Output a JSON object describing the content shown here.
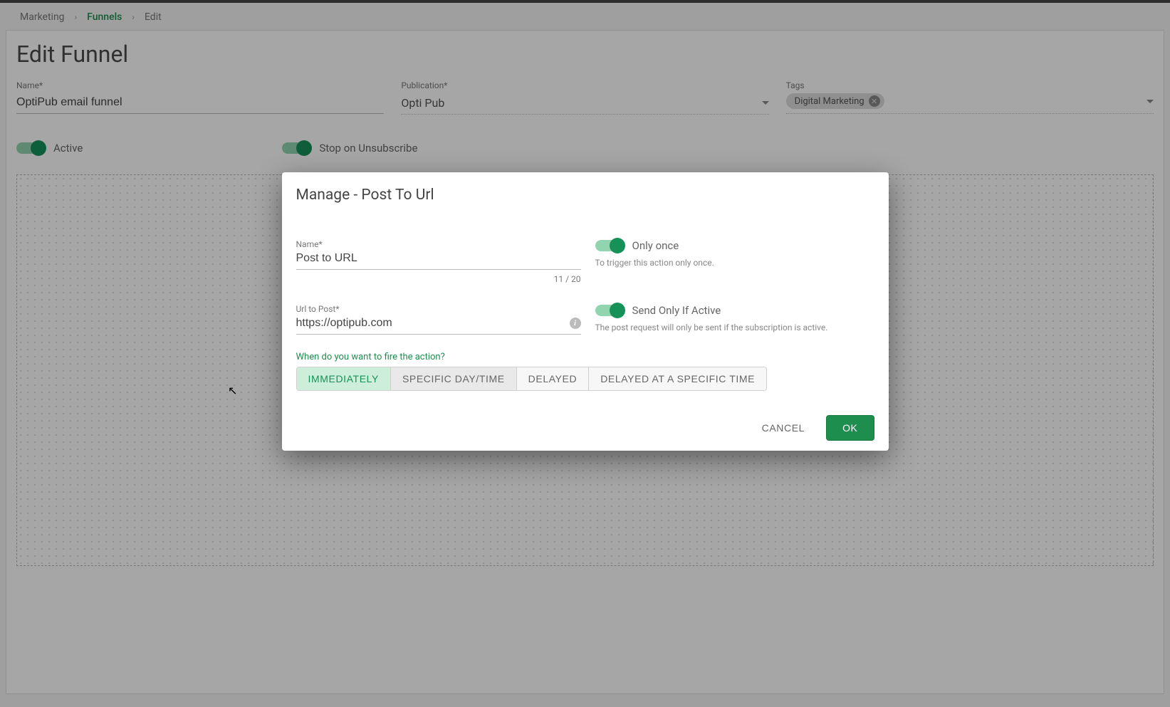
{
  "breadcrumb": {
    "items": [
      "Marketing",
      "Funnels",
      "Edit"
    ],
    "active_index": 1
  },
  "page": {
    "title": "Edit Funnel"
  },
  "fields": {
    "name_label": "Name*",
    "name_value": "OptiPub email funnel",
    "publication_label": "Publication*",
    "publication_value": "Opti Pub",
    "tags_label": "Tags",
    "tags": [
      "Digital Marketing"
    ]
  },
  "toggles": {
    "active_label": "Active",
    "stop_label": "Stop on Unsubscribe"
  },
  "modal": {
    "title": "Manage - Post To Url",
    "name_label": "Name*",
    "name_value": "Post to URL",
    "name_counter": "11 / 20",
    "url_label": "Url to Post*",
    "url_value": "https://optipub.com",
    "only_once_label": "Only once",
    "only_once_help": "To trigger this action only once.",
    "send_active_label": "Send Only If Active",
    "send_active_help": "The post request will only be sent if the subscription is active.",
    "when_label": "When do you want to fire the action?",
    "segments": [
      "IMMEDIATELY",
      "SPECIFIC DAY/TIME",
      "DELAYED",
      "DELAYED AT A SPECIFIC TIME"
    ],
    "selected_segment": 0,
    "cancel_label": "CANCEL",
    "ok_label": "OK"
  }
}
